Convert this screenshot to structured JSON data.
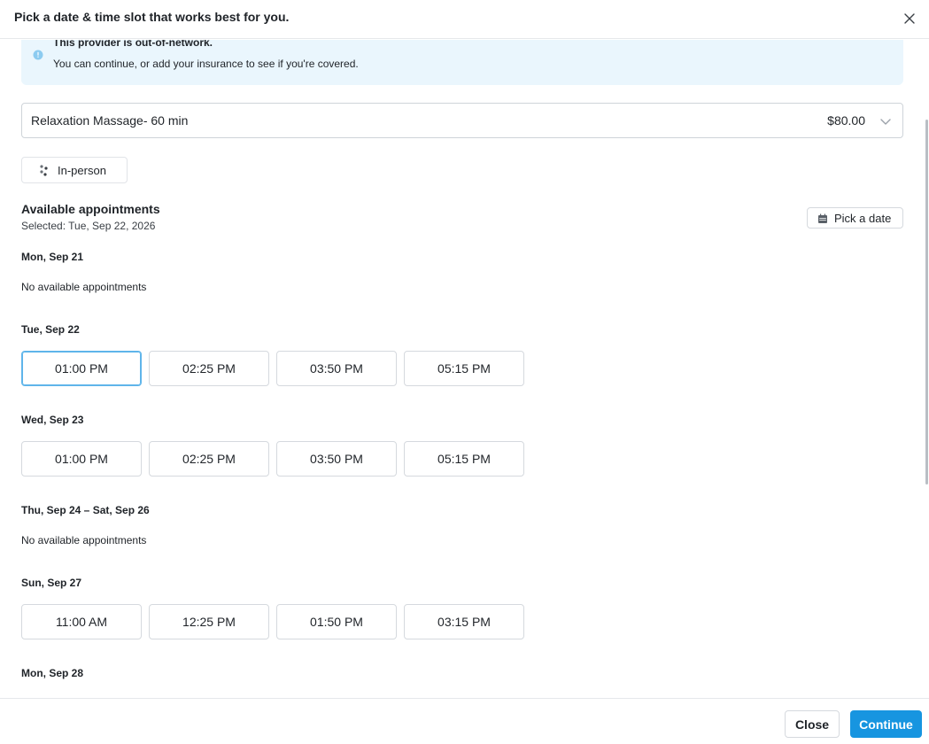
{
  "header": {
    "title": "Pick a date & time slot that works best for you.",
    "close_icon": "close-icon"
  },
  "notice": {
    "title": "This provider is out-of-network.",
    "message": "You can continue, or add your insurance to see if you're covered.",
    "icon": "info-icon",
    "color": "#eaf6fd"
  },
  "service": {
    "name": "Relaxation Massage- 60 min",
    "price": "$80.00"
  },
  "mode": {
    "label": "In-person",
    "icon": "person-icon"
  },
  "availability": {
    "title": "Available appointments",
    "selected": "Selected: Tue, Sep 22, 2026",
    "pick_date_label": "Pick a date"
  },
  "days": [
    {
      "label": "Mon, Sep 21",
      "none_text": "No available appointments"
    },
    {
      "label": "Tue, Sep 22",
      "slots": [
        "01:00 PM",
        "02:25 PM",
        "03:50 PM",
        "05:15 PM"
      ],
      "selected_slot": "01:00 PM"
    },
    {
      "label": "Wed, Sep 23",
      "slots": [
        "01:00 PM",
        "02:25 PM",
        "03:50 PM",
        "05:15 PM"
      ]
    },
    {
      "label": "Thu, Sep 24 – Sat, Sep 26",
      "none_text": "No available appointments"
    },
    {
      "label": "Sun, Sep 27",
      "slots": [
        "11:00 AM",
        "12:25 PM",
        "01:50 PM",
        "03:15 PM"
      ]
    },
    {
      "label": "Mon, Sep 28"
    }
  ],
  "footer": {
    "close_label": "Close",
    "continue_label": "Continue"
  },
  "colors": {
    "accent": "#1795e0",
    "selected_border": "#5fb5ea"
  }
}
